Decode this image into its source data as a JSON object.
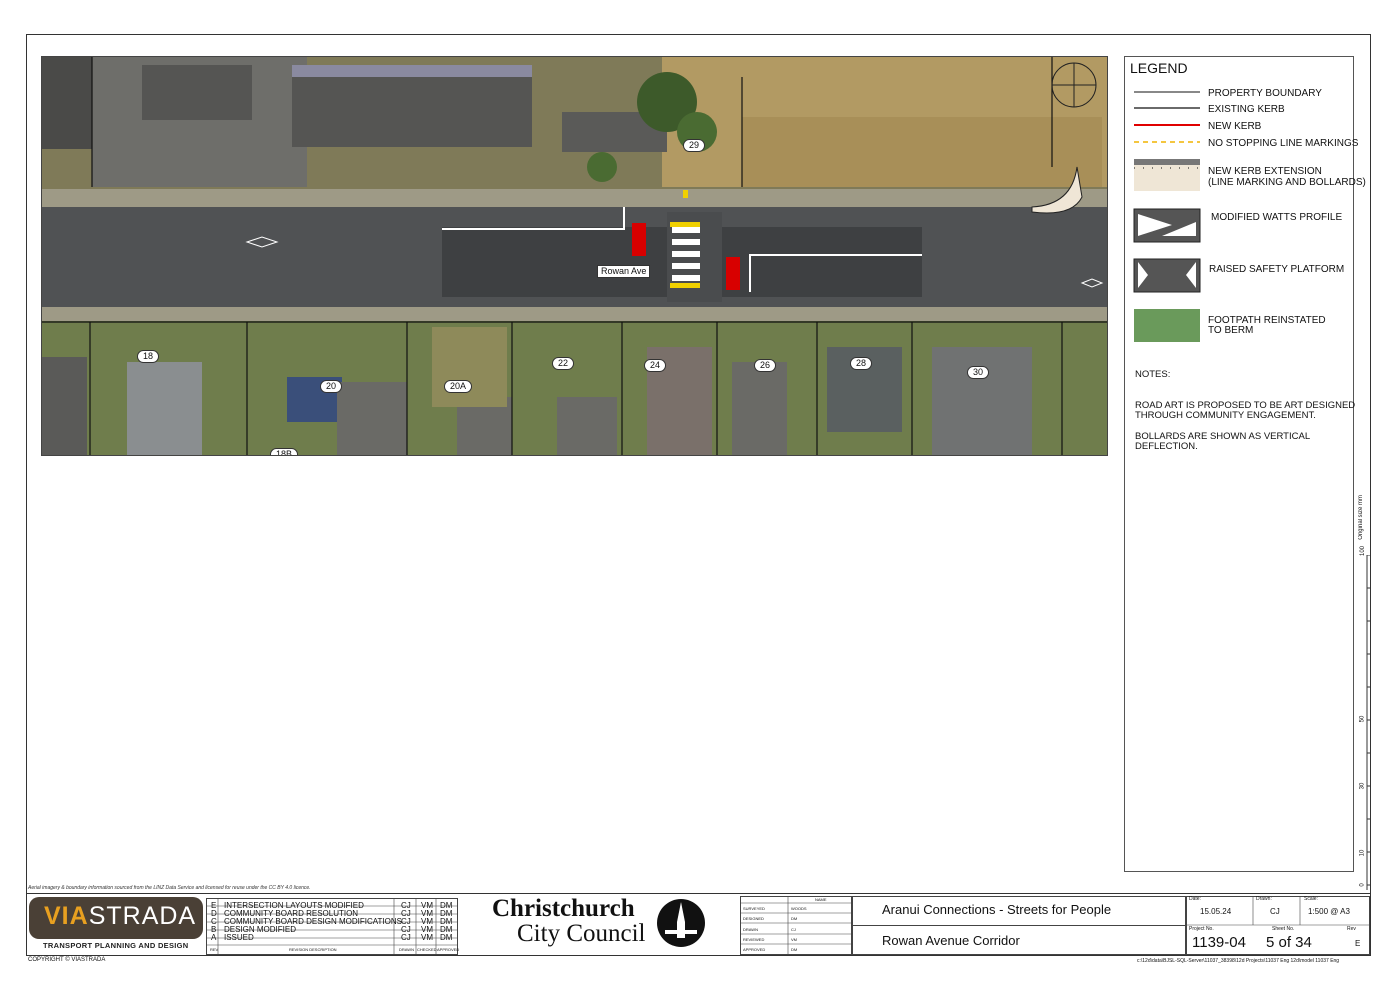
{
  "aerial": {
    "street_label": "Rowan Ave",
    "house_numbers": [
      "29",
      "18",
      "20",
      "20A",
      "22",
      "24",
      "26",
      "28",
      "30",
      "18B"
    ],
    "attribution": "Aerial imagery & boundary information sourced from the LINZ Data Service and licensed for reuse under the CC BY 4.0 licence.",
    "copyright": "COPYRIGHT © VIASTRADA"
  },
  "legend": {
    "title": "LEGEND",
    "items": [
      {
        "label": "PROPERTY BOUNDARY"
      },
      {
        "label": "EXISTING KERB"
      },
      {
        "label": "NEW KERB"
      },
      {
        "label": "NO STOPPING LINE MARKINGS"
      },
      {
        "label": "NEW KERB EXTENSION",
        "label2": "(LINE MARKING AND BOLLARDS)"
      },
      {
        "label": "MODIFIED WATTS PROFILE"
      },
      {
        "label": "RAISED SAFETY PLATFORM"
      },
      {
        "label": "FOOTPATH REINSTATED",
        "label2": "TO BERM"
      }
    ],
    "notes_title": "NOTES:",
    "notes": [
      "ROAD ART IS PROPOSED TO BE ART DESIGNED",
      "THROUGH COMMUNITY ENGAGEMENT.",
      "BOLLARDS ARE SHOWN AS VERTICAL",
      "DEFLECTION."
    ],
    "colors": {
      "new_kerb": "#e00000",
      "no_stopping": "#f0b400",
      "footpath": "#6a9a5b",
      "kerb_extension": "#efe6d6"
    }
  },
  "scale_bar": {
    "caption": "Original size mm",
    "ticks": [
      "100",
      "50",
      "30",
      "10",
      "0"
    ]
  },
  "title_block": {
    "company_name_via": "VIA",
    "company_name_strada": "STRADA",
    "company_tagline": "TRANSPORT PLANNING AND DESIGN",
    "revisions": [
      {
        "rev": "E",
        "desc": "INTERSECTION LAYOUTS MODIFIED",
        "drawn": "CJ",
        "checked": "VM",
        "approved": "DM"
      },
      {
        "rev": "D",
        "desc": "COMMUNITY BOARD RESOLUTION",
        "drawn": "CJ",
        "checked": "VM",
        "approved": "DM"
      },
      {
        "rev": "C",
        "desc": "COMMUNITY BOARD DESIGN MODIFICATIONS",
        "drawn": "CJ",
        "checked": "VM",
        "approved": "DM"
      },
      {
        "rev": "B",
        "desc": "DESIGN MODIFIED",
        "drawn": "CJ",
        "checked": "VM",
        "approved": "DM"
      },
      {
        "rev": "A",
        "desc": "ISSUED",
        "drawn": "CJ",
        "checked": "VM",
        "approved": "DM"
      }
    ],
    "rev_headers": {
      "rev": "REV",
      "desc": "REVISION DESCRIPTION",
      "drawn": "DRAWN",
      "checked": "CHECKED",
      "approved": "APPROVED"
    },
    "council_line1": "Christchurch",
    "council_line2": "City Council",
    "signoff_header": "NAME",
    "signoff": [
      {
        "role": "SURVEYED",
        "name": "WOODS"
      },
      {
        "role": "DESIGNED",
        "name": "DM"
      },
      {
        "role": "DRAWN",
        "name": "CJ"
      },
      {
        "role": "REVIEWED",
        "name": "VM"
      },
      {
        "role": "APPROVED",
        "name": "DM"
      }
    ],
    "project_title": "Aranui Connections - Streets for People",
    "drawing_title": "Rowan Avenue Corridor",
    "date_label": "Date:",
    "date": "15.05.24",
    "drawn_label": "Drawn:",
    "drawn": "CJ",
    "scale_label": "Scale:",
    "scale": "1:500 @ A3",
    "project_no_label": "Project No.",
    "project_no": "1139-04",
    "sheet_label": "Sheet No.",
    "sheet": "5 of 34",
    "rev_label": "Rev",
    "rev": "E",
    "file_path": "c:\\12d\\data\\BJSL-SQL-Server\\11037_38398\\12d Projects\\11037 Eng 12d\\model 11037 Eng"
  }
}
